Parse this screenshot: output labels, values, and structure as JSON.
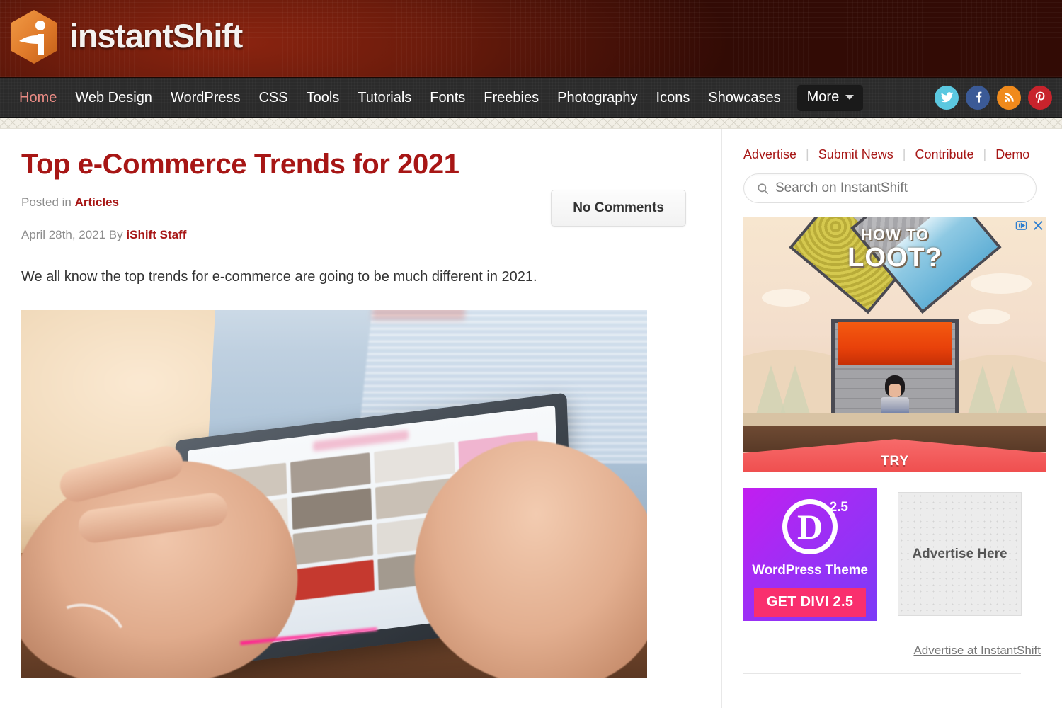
{
  "site": {
    "logo_text": "instantShift",
    "logo_icon": "hexagon-i-logo"
  },
  "nav": {
    "items": [
      {
        "label": "Home",
        "active": true
      },
      {
        "label": "Web Design",
        "active": false
      },
      {
        "label": "WordPress",
        "active": false
      },
      {
        "label": "CSS",
        "active": false
      },
      {
        "label": "Tools",
        "active": false
      },
      {
        "label": "Tutorials",
        "active": false
      },
      {
        "label": "Fonts",
        "active": false
      },
      {
        "label": "Freebies",
        "active": false
      },
      {
        "label": "Photography",
        "active": false
      },
      {
        "label": "Icons",
        "active": false
      },
      {
        "label": "Showcases",
        "active": false
      }
    ],
    "more_label": "More",
    "social": [
      {
        "name": "twitter-icon",
        "color": "#5bc8e0"
      },
      {
        "name": "facebook-icon",
        "color": "#3b5a96"
      },
      {
        "name": "rss-icon",
        "color": "#f08a1c"
      },
      {
        "name": "pinterest-icon",
        "color": "#c8232c"
      }
    ]
  },
  "article": {
    "title": "Top e-Commerce Trends for 2021",
    "posted_in_label": "Posted in",
    "category": "Articles",
    "date": "April 28th, 2021 By",
    "author": "iShift Staff",
    "comments_label": "No Comments",
    "intro": "We all know the top trends for e-commerce are going to be much different in 2021.",
    "photo_alt": "hands-using-tablet-photo"
  },
  "sidebar": {
    "links": [
      {
        "label": "Advertise"
      },
      {
        "label": "Submit News"
      },
      {
        "label": "Contribute"
      },
      {
        "label": "Demo"
      }
    ],
    "separator": "|",
    "search": {
      "placeholder": "Search on InstantShift",
      "value": ""
    },
    "ad_banner": {
      "headline_line1": "HOW TO",
      "headline_line2": "LOOT?",
      "cta": "TRY",
      "adchoices_icon": "adchoices-icon",
      "close_icon": "close-icon"
    },
    "divi_ad": {
      "letter": "D",
      "version": "2.5",
      "subtitle": "WordPress Theme",
      "button": "GET DIVI 2.5"
    },
    "advertise_here": {
      "label": "Advertise Here"
    },
    "advertise_link": "Advertise at InstantShift"
  },
  "colors": {
    "brand_red": "#a71615",
    "header_dark_red": "#6d1c0c",
    "nav_dark": "#2b2b2b",
    "logo_orange": "#e07a2a",
    "active_nav": "#e98b84"
  }
}
